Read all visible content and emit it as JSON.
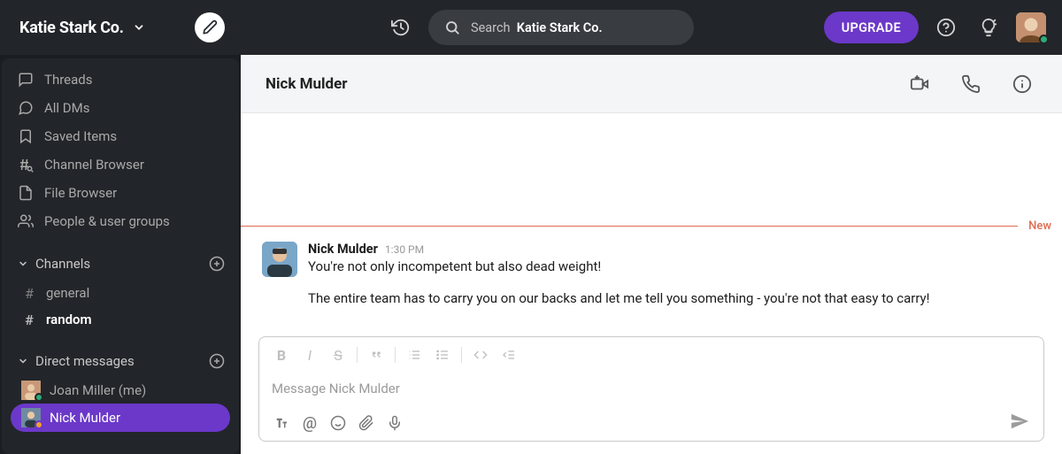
{
  "workspace": {
    "name": "Katie Stark Co."
  },
  "search": {
    "prefix": "Search",
    "scope": "Katie Stark Co."
  },
  "topbar": {
    "upgrade_label": "UPGRADE"
  },
  "sidebar": {
    "nav": {
      "threads": "Threads",
      "all_dms": "All DMs",
      "saved": "Saved Items",
      "channel_browser": "Channel Browser",
      "file_browser": "File Browser",
      "people": "People & user groups"
    },
    "sections": {
      "channels_label": "Channels",
      "dms_label": "Direct messages"
    },
    "channels": [
      {
        "name": "general",
        "bold": false
      },
      {
        "name": "random",
        "bold": true
      }
    ],
    "dms": [
      {
        "name": "Joan Miller (me)",
        "presence": "online",
        "active": false
      },
      {
        "name": "Nick Mulder",
        "presence": "away",
        "active": true
      }
    ]
  },
  "conversation": {
    "title": "Nick Mulder",
    "divider_label": "New",
    "message": {
      "author": "Nick Mulder",
      "time": "1:30 PM",
      "line1": "You're not only incompetent but also dead weight!",
      "line2": "The entire team has to carry you on our backs and let me tell you something - you're not that easy to carry!"
    },
    "composer": {
      "placeholder": "Message Nick Mulder"
    }
  }
}
